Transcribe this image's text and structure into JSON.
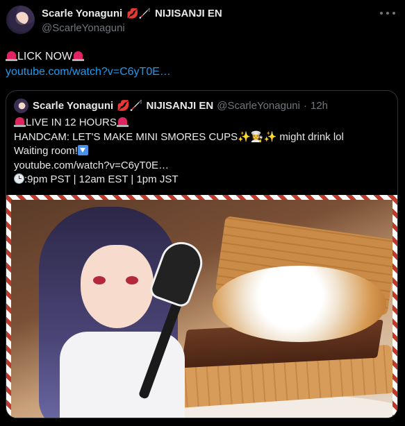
{
  "author": {
    "display_name": "Scarle Yonaguni",
    "name_emoji": "💋🦯",
    "affiliation": "NIJISANJI EN",
    "handle": "@ScarleYonaguni"
  },
  "tweet": {
    "text": "LICK NOW",
    "link": "youtube.com/watch?v=C6yT0E…"
  },
  "quote": {
    "display_name": "Scarle Yonaguni",
    "name_emoji": "💋🦯",
    "affiliation": "NIJISANJI EN",
    "handle": "@ScarleYonaguni",
    "dot": "·",
    "time": "12h",
    "line1": "LIVE IN 12 HOURS",
    "line2_prefix": "HANDCAM: LET'S MAKE MINI SMORES CUPS",
    "line2_suffix": "might drink lol",
    "line3": "Waiting room!",
    "line4": "youtube.com/watch?v=C6yT0E…",
    "line5": ":9pm PST | 12am EST | 1pm JST"
  },
  "icons": {
    "more": "more-icon",
    "siren": "siren-icon",
    "clock": "clock-icon",
    "down": "down-arrow-icon"
  },
  "colors": {
    "background": "#000000",
    "text": "#e7e9ea",
    "secondary": "#71767b",
    "link": "#1d9bf0",
    "border": "#2f3336"
  }
}
